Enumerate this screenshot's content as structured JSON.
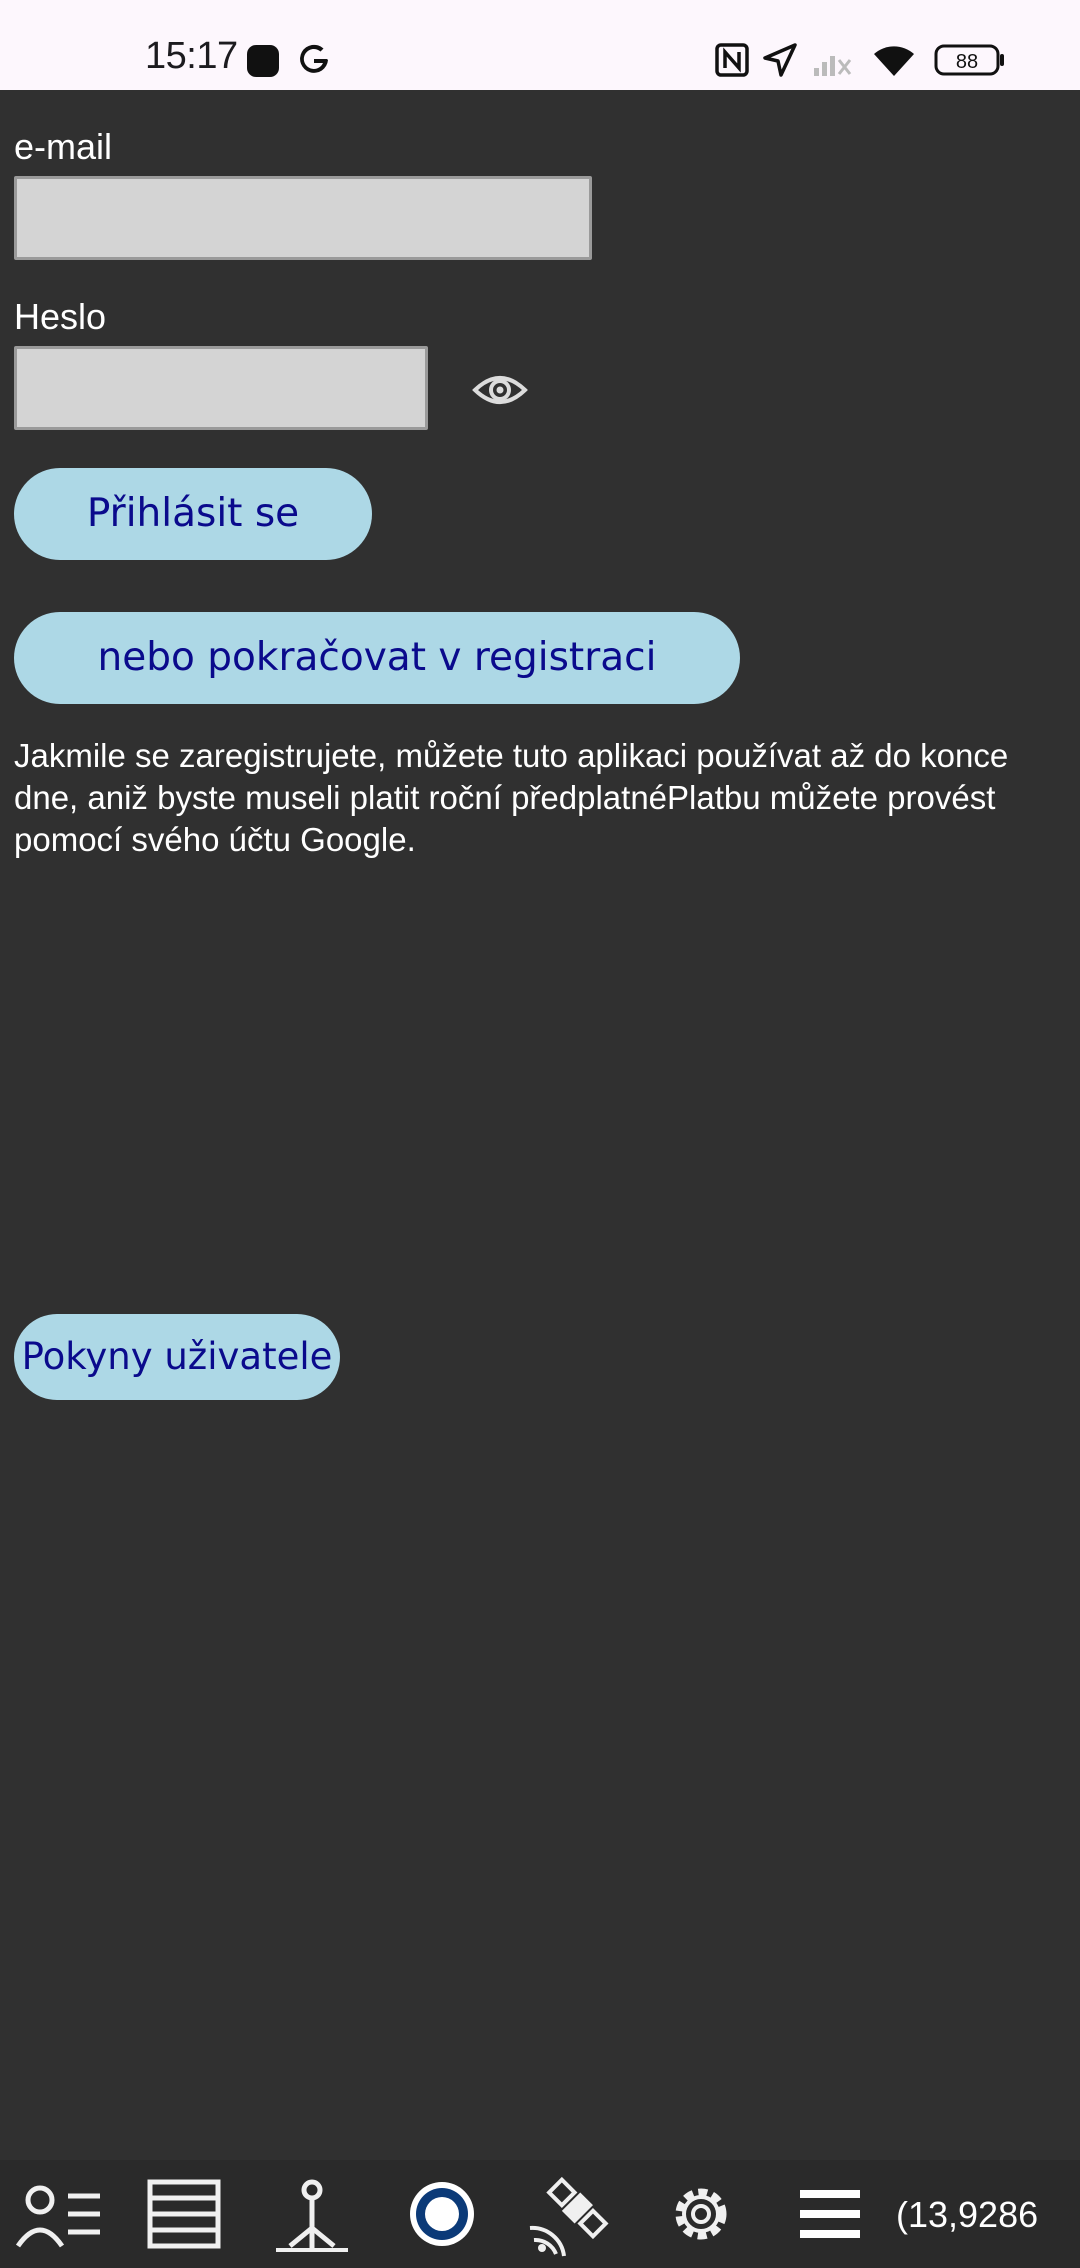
{
  "status_bar": {
    "time": "15:17",
    "battery": "88",
    "icons": [
      "app-notification-icon",
      "google-icon",
      "nfc-icon",
      "location-icon",
      "signal-off-icon",
      "wifi-icon",
      "battery-icon"
    ]
  },
  "login": {
    "email_label": "e-mail",
    "email_value": "",
    "password_label": "Heslo",
    "password_value": "",
    "password_toggle_icon": "eye-icon",
    "login_button": "Přihlásit se",
    "register_button": "nebo pokračovat v registraci",
    "info_text": "Jakmile se zaregistrujete, můžete tuto aplikaci používat až do konce dne, aniž byste museli platit roční předplatnéPlatbu můžete provést pomocí svého účtu Google.",
    "user_guide_button": "Pokyny uživatele"
  },
  "toolbar": {
    "items": [
      {
        "icon": "user-list-icon"
      },
      {
        "icon": "layers-list-icon"
      },
      {
        "icon": "survey-point-icon"
      },
      {
        "icon": "record-icon"
      },
      {
        "icon": "satellite-icon"
      },
      {
        "icon": "settings-gear-icon"
      },
      {
        "icon": "hamburger-menu-icon"
      }
    ],
    "coordinate": "(13,9286"
  },
  "colors": {
    "background": "#303030",
    "button_fill": "#add8e6",
    "button_text": "#0a0a8c",
    "input_fill": "#d4d4d4",
    "status_bar": "#fdf7fd"
  }
}
